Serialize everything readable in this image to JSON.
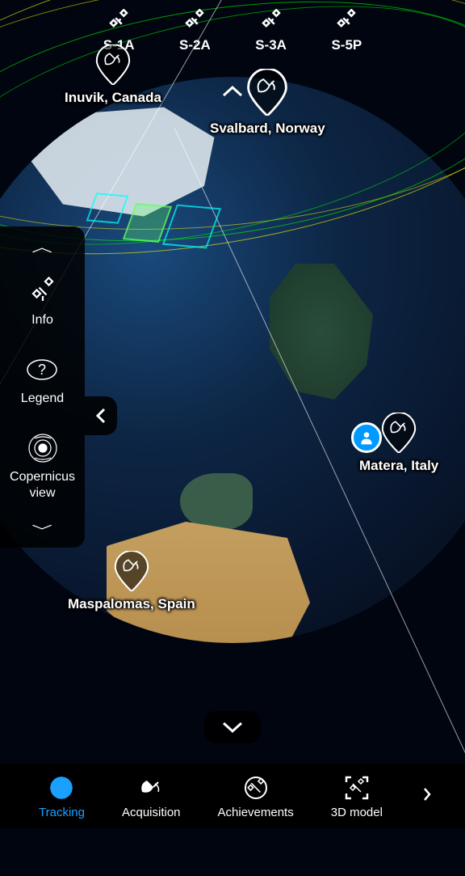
{
  "satellites": [
    {
      "name": "S-1A"
    },
    {
      "name": "S-2A"
    },
    {
      "name": "S-3A"
    },
    {
      "name": "S-5P"
    }
  ],
  "side_panel": {
    "info_label": "Info",
    "legend_label": "Legend",
    "copernicus_label": "Copernicus view"
  },
  "ground_stations": {
    "svalbard": "Svalbard, Norway",
    "inuvik": "Inuvik, Canada",
    "matera": "Matera, Italy",
    "maspalomas": "Maspalomas, Spain"
  },
  "bottom_nav": {
    "tracking": "Tracking",
    "acquisition": "Acquisition",
    "achievements": "Achievements",
    "model3d": "3D model"
  }
}
